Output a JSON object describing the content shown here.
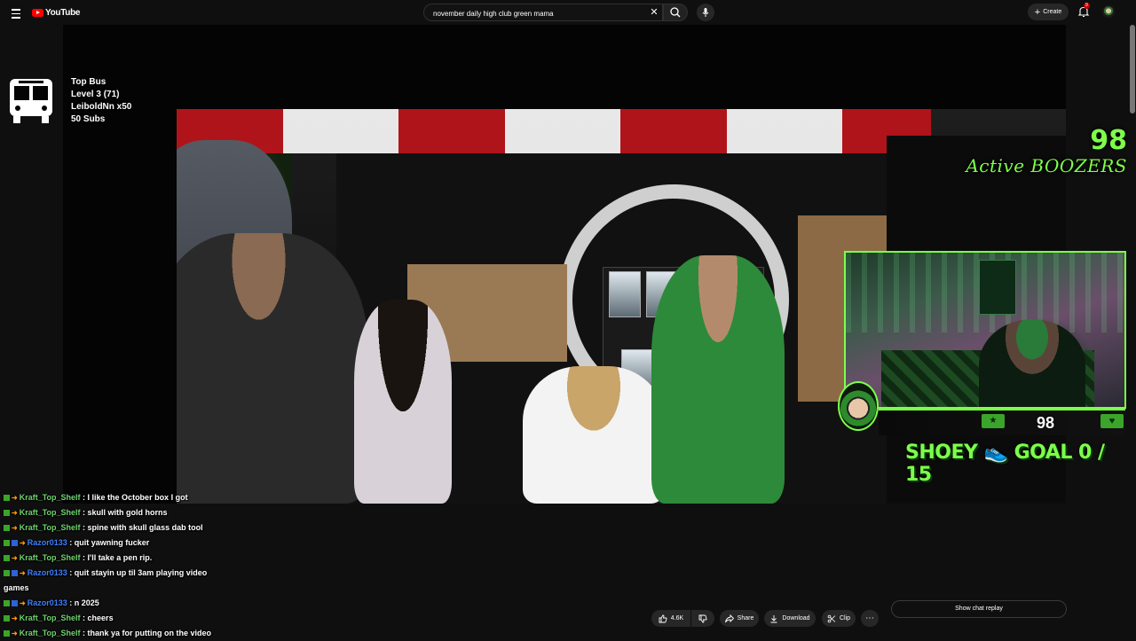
{
  "youtube": {
    "logo_text": "YouTube",
    "search_value": "november daily high club green mama",
    "create_label": "Create",
    "notifications_count": "9"
  },
  "overlay": {
    "top_bus": {
      "lines": [
        "Top Bus",
        "Level 3  (71)",
        "LeiboldNn x50",
        "50 Subs"
      ]
    },
    "active_count": "98",
    "active_label": "Active BOOZERS",
    "cam_counter": "98",
    "goal_text": "SHOEY 👟 GOAL  0 / 15"
  },
  "chat": [
    {
      "user": "Kraft_Top_Shelf",
      "type": "kraft",
      "msg": "I like the October box I got"
    },
    {
      "user": "Kraft_Top_Shelf",
      "type": "kraft",
      "msg": "skull with gold horns"
    },
    {
      "user": "Kraft_Top_Shelf",
      "type": "kraft",
      "msg": "spine with skull glass dab tool"
    },
    {
      "user": "Razor0133",
      "type": "razor",
      "msg": "quit yawning fucker"
    },
    {
      "user": "Kraft_Top_Shelf",
      "type": "kraft",
      "msg": "I'll take a pen rip."
    },
    {
      "user": "Razor0133",
      "type": "razor",
      "msg": "quit stayin up til 3am playing video games"
    },
    {
      "user": "Razor0133",
      "type": "razor",
      "msg": "n 2025"
    },
    {
      "user": "Kraft_Top_Shelf",
      "type": "kraft",
      "msg": "cheers"
    },
    {
      "user": "Kraft_Top_Shelf",
      "type": "kraft",
      "msg": "thank ya for putting on the video"
    }
  ],
  "actions": {
    "like_count": "4.6K",
    "share_label": "Share",
    "download_label": "Download",
    "clip_label": "Clip",
    "show_chat_replay": "Show chat replay"
  },
  "colors": {
    "overlay_green": "#7dff4a",
    "kraft_name": "#6fd36f",
    "razor_name": "#3f7fff",
    "yt_red": "#ff0000"
  }
}
